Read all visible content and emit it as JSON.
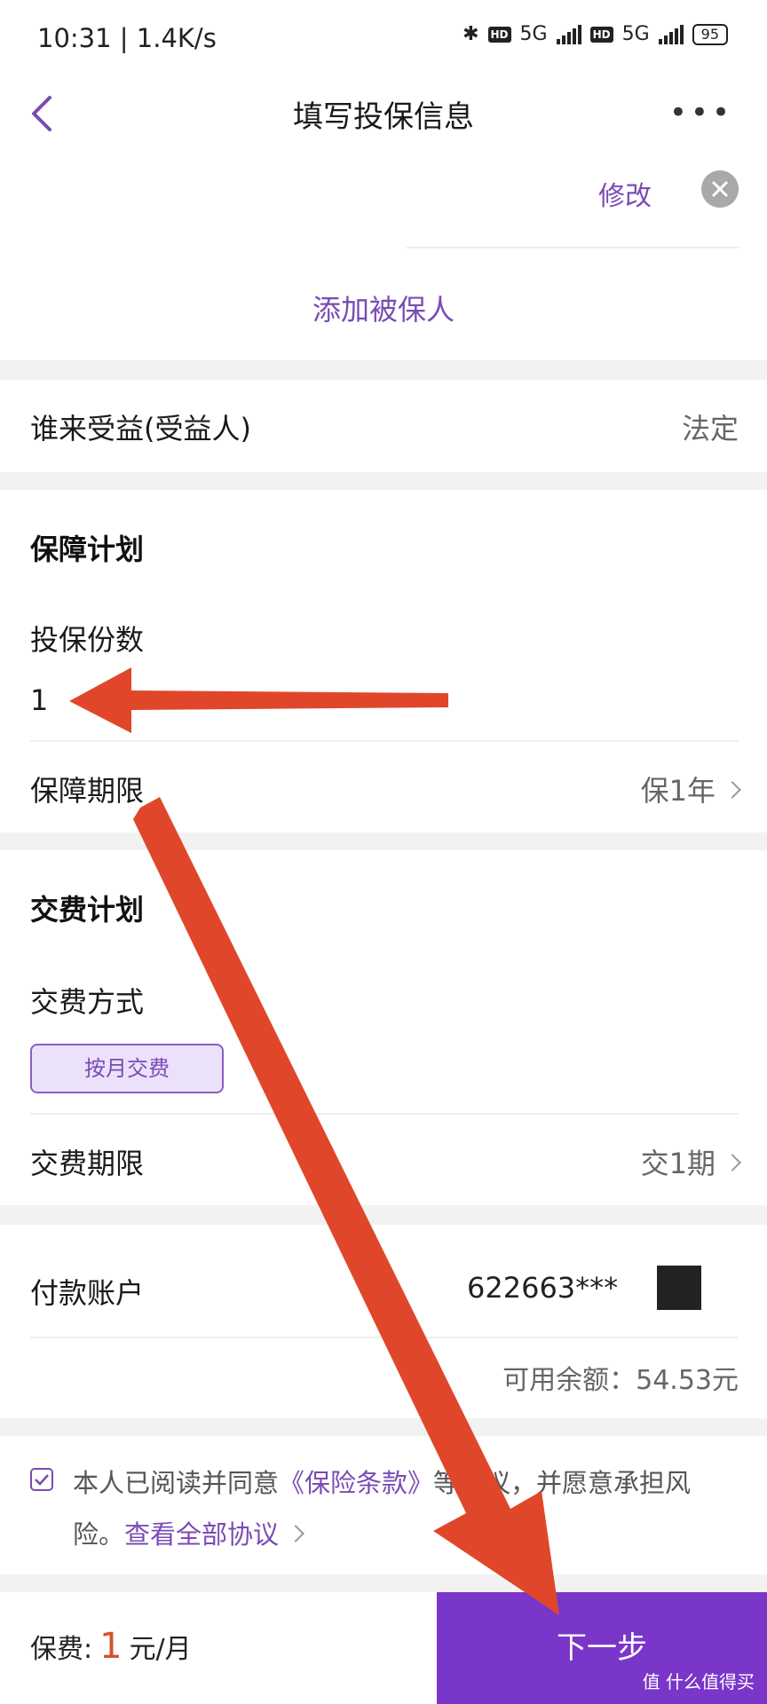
{
  "status": {
    "time": "10:31 | 1.4K/s",
    "hd": "HD",
    "net": "5G",
    "battery": "95"
  },
  "nav": {
    "title": "填写投保信息"
  },
  "insured": {
    "edit_label": "修改",
    "add_label": "添加被保人"
  },
  "beneficiary": {
    "label": "谁来受益(受益人)",
    "value": "法定"
  },
  "coverage": {
    "section_title": "保障计划",
    "copies_label": "投保份数",
    "copies_value": "1",
    "period_label": "保障期限",
    "period_value": "保1年"
  },
  "payment_plan": {
    "section_title": "交费计划",
    "method_label": "交费方式",
    "method_option": "按月交费",
    "term_label": "交费期限",
    "term_value": "交1期"
  },
  "account": {
    "label": "付款账户",
    "number": "622663***",
    "balance": "可用余额：54.53元"
  },
  "agreement": {
    "text1": "本人已阅读并同意",
    "terms_link": "《保险条款》",
    "text2": "等协议，并愿意承担风险。",
    "view_all_link": "查看全部协议"
  },
  "footer": {
    "fee_label": "保费:",
    "fee_amount": "1",
    "fee_unit": "元/月",
    "next_label": "下一步",
    "watermark": "值 什么值得买"
  },
  "colors": {
    "accent": "#7a4bb5",
    "button": "#7a35c9",
    "price": "#d2522b",
    "annotation_arrow": "#e0472a"
  }
}
